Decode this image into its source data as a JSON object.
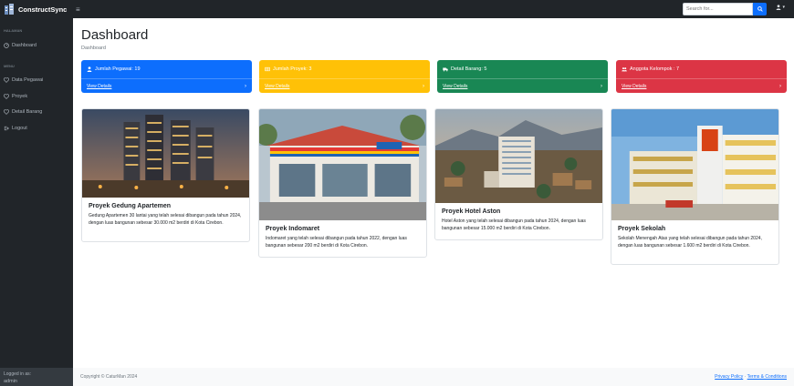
{
  "brand": {
    "name": "ConstructSync"
  },
  "topnav": {
    "toggle_icon": "bars-icon",
    "search_placeholder": "Search for...",
    "user_menu_caret": "▾"
  },
  "sidebar": {
    "heading_main": "HALAMAN",
    "heading_menu": "MENU",
    "items": [
      {
        "label": "Dashboard",
        "icon": "gauge-icon"
      },
      {
        "label": "Data Pegawai",
        "icon": "heart-icon"
      },
      {
        "label": "Proyek",
        "icon": "heart-icon"
      },
      {
        "label": "Detail Barang",
        "icon": "heart-icon"
      },
      {
        "label": "Logout",
        "icon": "logout-icon"
      }
    ],
    "footer": {
      "logged_in_as": "Logged in as:",
      "user": "admin"
    }
  },
  "page": {
    "title": "Dashboard",
    "breadcrumb": "Dashboard"
  },
  "stats": [
    {
      "label": "Jumlah Pegawai: 19",
      "link": "View Details",
      "color": "#0d6efd",
      "icon": "user-icon"
    },
    {
      "label": "Jumlah Proyek: 3",
      "link": "View Details",
      "color": "#ffc107",
      "icon": "table-icon"
    },
    {
      "label": "Detail Barang: 5",
      "link": "View Details",
      "color": "#198754",
      "icon": "truck-icon"
    },
    {
      "label": "Anggota Kelompok : 7",
      "link": "View Details",
      "color": "#dc3545",
      "icon": "users-icon"
    }
  ],
  "projects": [
    {
      "title": "Proyek Gedung Apartemen",
      "text": "Gedung Apartemen 30 lantai yang telah selesai dibangun pada tahun 2024, dengan luas bangunan sebesar 30.000 m2 berdiri di Kota Cirebon."
    },
    {
      "title": "Proyek Indomaret",
      "text": "Indomaret yang telah selesai dibangun pada tahun 2022, dengan luas bangunan sebesar 200 m2 berdiri di Kota Cirebon."
    },
    {
      "title": "Proyek Hotel Aston",
      "text": "Hotel Aston yang telah selesai dibangun pada tahun 2024, dengan luas bangunan sebesar 15.000 m2 berdiri di Kota Cirebon."
    },
    {
      "title": "Proyek Sekolah",
      "text": "Sekolah Menengah Atas yang telah selesai dibangun pada tahun 2024, dengan luas bangunan sebesar 1.600 m2 berdiri di Kota Cirebon."
    }
  ],
  "footer": {
    "copyright": "Copyright © CaturMan 2024",
    "privacy": "Privacy Policy",
    "sep": " · ",
    "terms": "Terms & Conditions"
  }
}
